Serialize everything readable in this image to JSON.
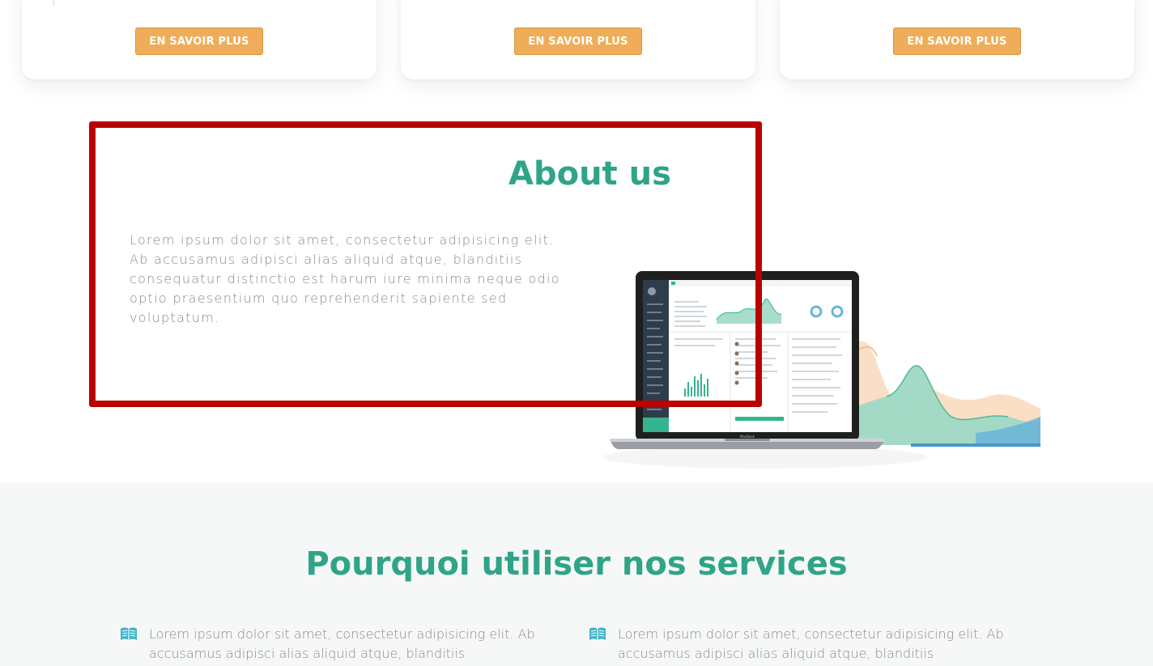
{
  "cards": [
    {
      "button_label": "EN SAVOIR PLUS"
    },
    {
      "button_label": "EN SAVOIR PLUS"
    },
    {
      "button_label": "EN SAVOIR PLUS"
    }
  ],
  "about": {
    "title": "About us",
    "text": "Lorem ipsum dolor sit amet, consectetur adipisicing elit. Ab accusamus adipisci alias aliquid atque, blanditiis consequatur distinctio est harum iure minima neque odio optio praesentium quo reprehenderit sapiente sed voluptatum.",
    "laptop_label": "MacBook"
  },
  "why": {
    "title": "Pourquoi utiliser nos services",
    "items": [
      {
        "icon": "book-open-icon",
        "text": "Lorem ipsum dolor sit amet, consectetur adipisicing elit. Ab accusamus adipisci alias aliquid atque, blanditiis"
      },
      {
        "icon": "book-open-icon",
        "text": "Lorem ipsum dolor sit amet, consectetur adipisicing elit. Ab accusamus adipisci alias aliquid atque, blanditiis"
      }
    ]
  },
  "colors": {
    "accent_green": "#2fa487",
    "button_orange": "#f0ad59",
    "highlight_red": "#bb0000",
    "icon_teal": "#3fb4c7"
  }
}
